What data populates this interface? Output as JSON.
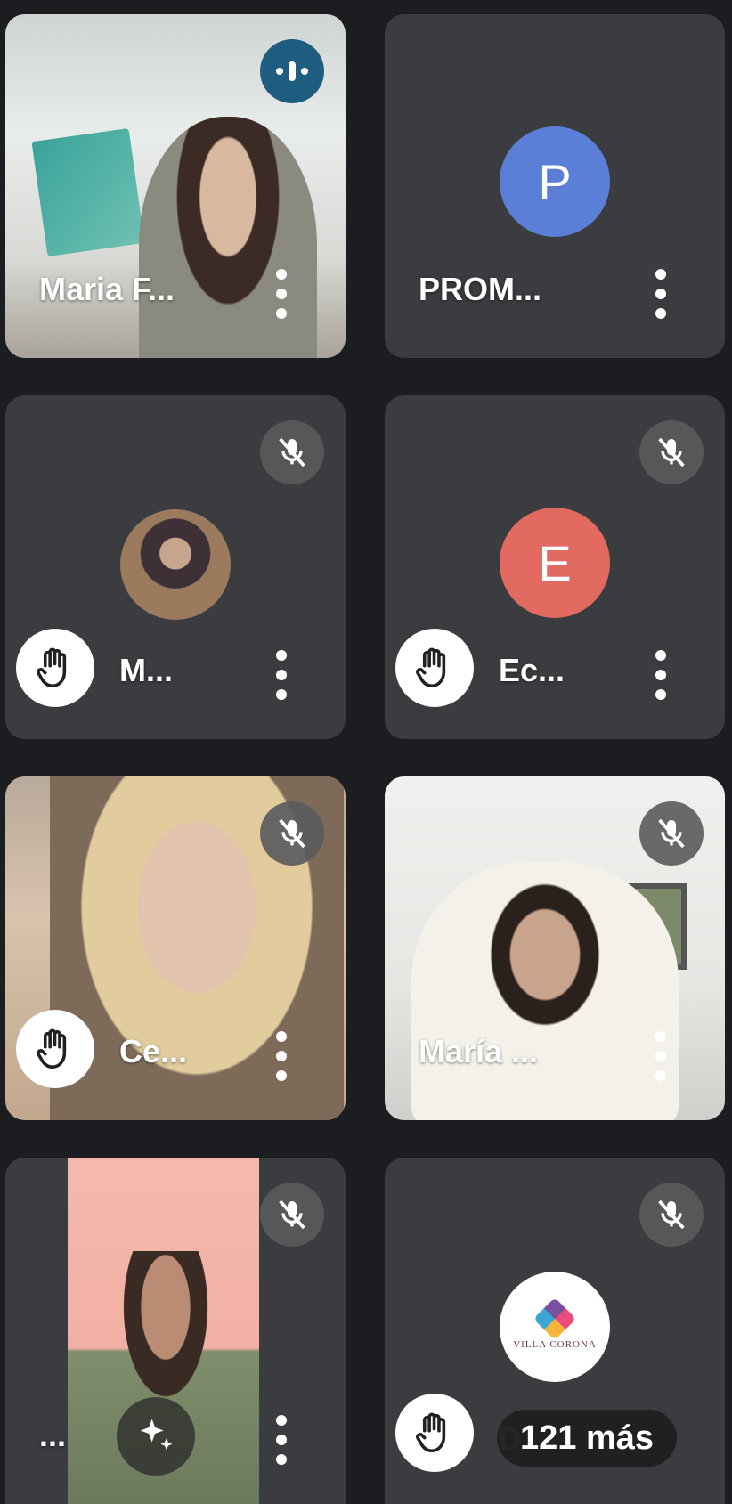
{
  "participants": [
    {
      "id": "t1",
      "name": "Maria F...",
      "status": "speaking"
    },
    {
      "id": "t2",
      "name": "PROM...",
      "avatar_letter": "P",
      "avatar_color": "#5b7fd6"
    },
    {
      "id": "t3",
      "name": "M...",
      "status": "muted",
      "hand_raised": true
    },
    {
      "id": "t4",
      "name": "Ec...",
      "avatar_letter": "E",
      "avatar_color": "#e26a61",
      "status": "muted",
      "hand_raised": true
    },
    {
      "id": "t5",
      "name": "Ce...",
      "status": "muted",
      "hand_raised": true
    },
    {
      "id": "t6",
      "name": "María ...",
      "status": "muted"
    },
    {
      "id": "t7",
      "name": "...",
      "status": "muted"
    },
    {
      "id": "t8",
      "logo_text": "VILLA CORONA",
      "status": "muted",
      "hand_raised": true,
      "ghost_name": "D",
      "more_label": "121 más"
    }
  ],
  "colors": {
    "background": "#1c1d20",
    "tile": "#3b3c40",
    "speaking_badge": "#1f5d80",
    "muted_badge": "#5a5a5c"
  }
}
